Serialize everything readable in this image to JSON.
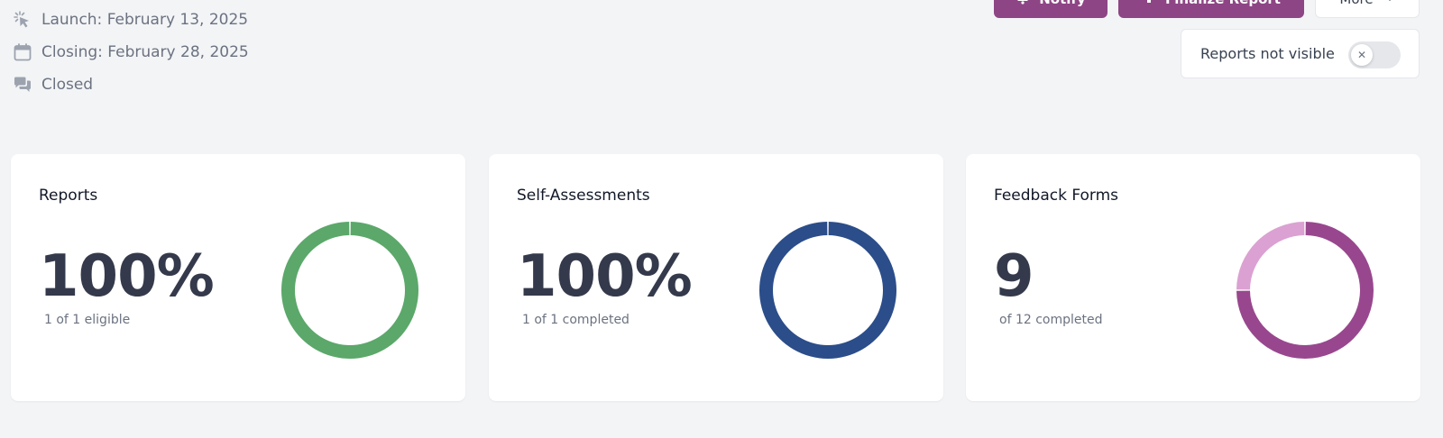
{
  "meta": {
    "launch": "Launch: February 13, 2025",
    "closing": "Closing: February 28, 2025",
    "status": "Closed"
  },
  "actions": {
    "notify_label": "Notify",
    "finalize_label": "Finalize Report",
    "more_label": "More",
    "visibility_label": "Reports not visible",
    "visibility_on": false
  },
  "colors": {
    "accent_purple": "#8e4585",
    "green": "#5ba86a",
    "blue": "#2b4d8a",
    "purple": "#98478e",
    "light_purple": "#dba1d2"
  },
  "cards": [
    {
      "title": "Reports",
      "value": "100%",
      "subtitle": "1 of 1 eligible",
      "completed": 1,
      "total": 1,
      "color": "#5ba86a",
      "rest_color": "#a6d3ae"
    },
    {
      "title": "Self-Assessments",
      "value": "100%",
      "subtitle": "1 of 1 completed",
      "completed": 1,
      "total": 1,
      "color": "#2b4d8a",
      "rest_color": "#9fb2d6"
    },
    {
      "title": "Feedback Forms",
      "value": "9",
      "subtitle": "of 12 completed",
      "completed": 9,
      "total": 12,
      "color": "#98478e",
      "rest_color": "#dba1d2"
    }
  ]
}
